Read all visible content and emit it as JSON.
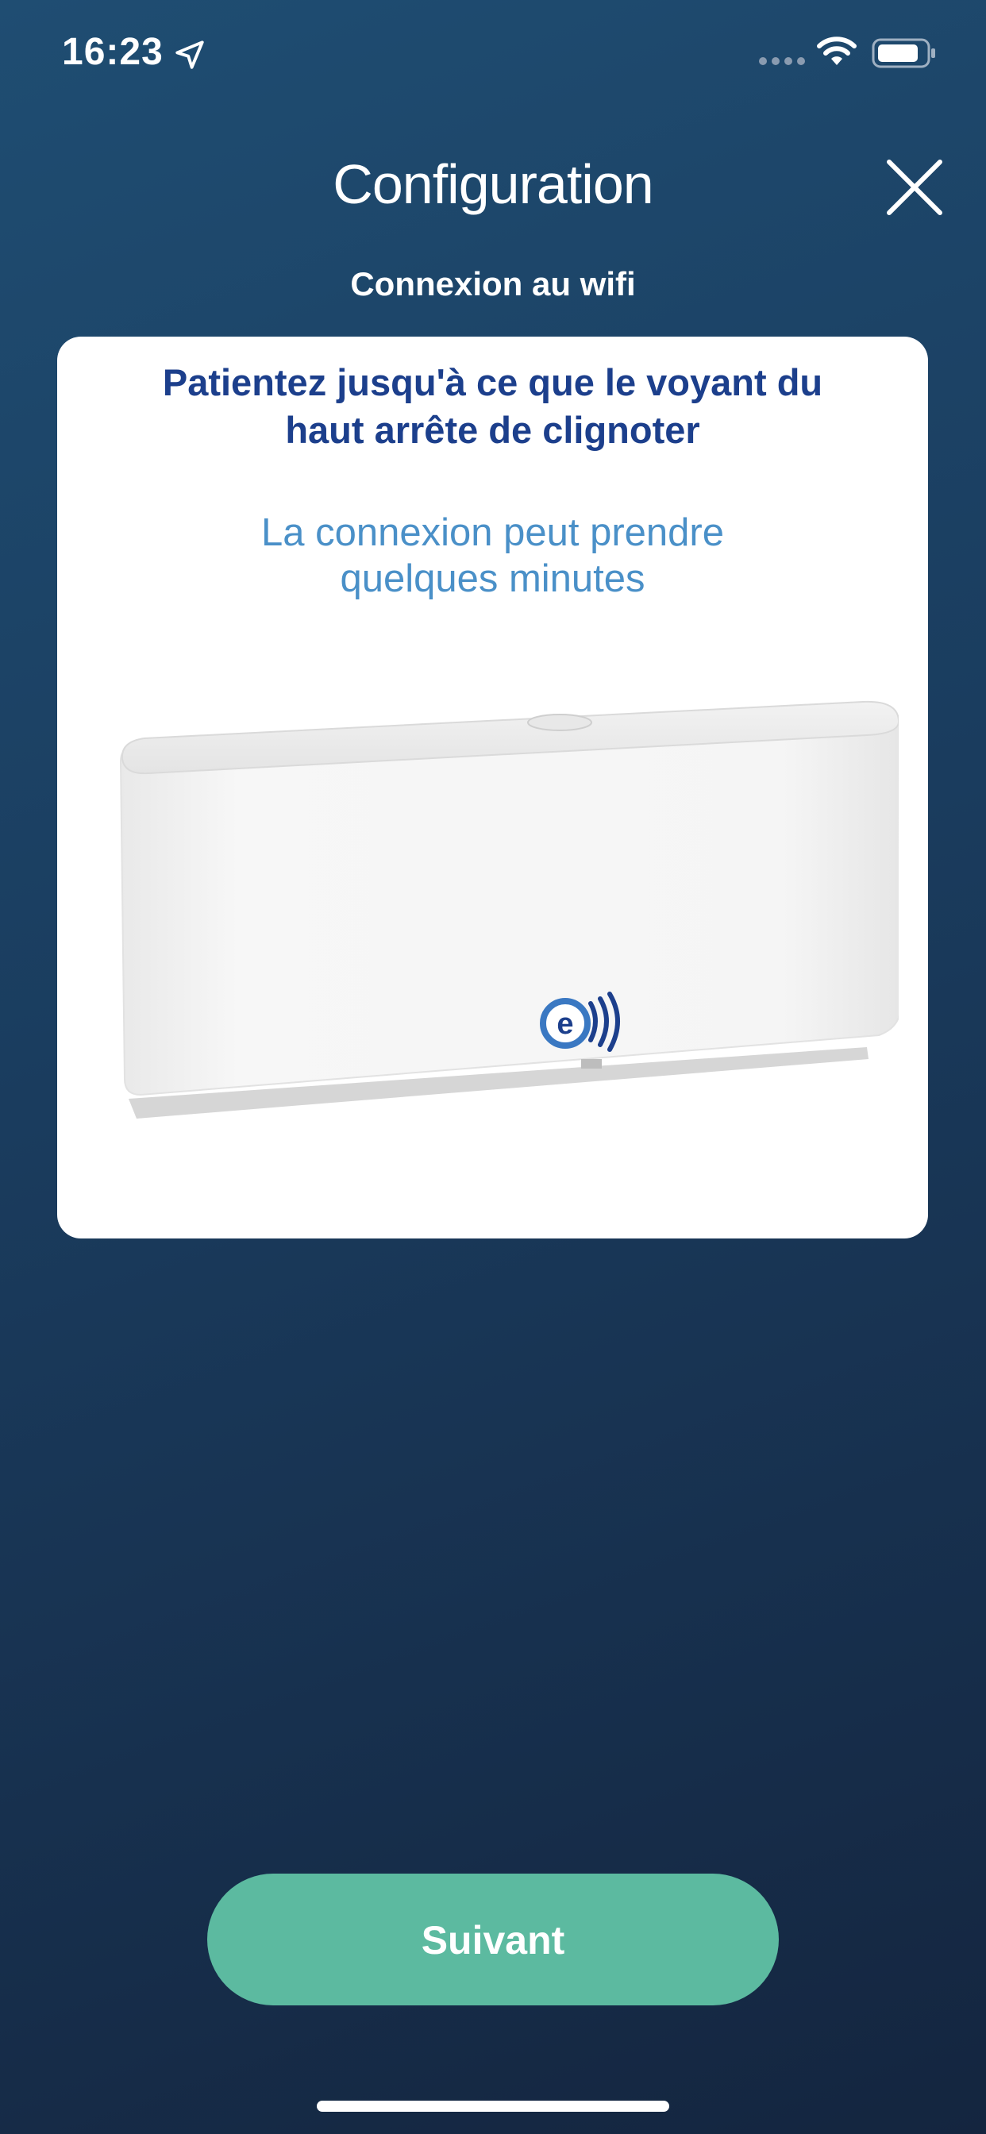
{
  "status_bar": {
    "time": "16:23",
    "icons": [
      "location-arrow-icon",
      "cellular-signal-icon",
      "wifi-icon",
      "battery-icon"
    ]
  },
  "header": {
    "title": "Configuration",
    "close_icon": "close-icon"
  },
  "step": {
    "subtitle": "Connexion au wifi"
  },
  "card": {
    "heading_line1": "Patientez jusqu'à ce que le voyant du",
    "heading_line2": "haut arrête de clignoter",
    "subtext_line1": "La connexion peut prendre",
    "subtext_line2": "quelques minutes",
    "image": "wifi-hub-device"
  },
  "footer": {
    "next_label": "Suivant"
  },
  "colors": {
    "background_top": "#1f4d72",
    "background_bottom": "#14253f",
    "heading": "#1c3f8c",
    "subtext": "#4a90c8",
    "button": "#5cbaa0"
  }
}
